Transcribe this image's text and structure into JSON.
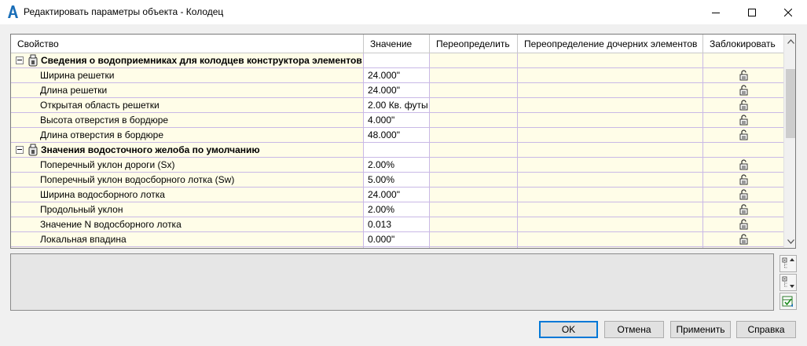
{
  "window": {
    "title": "Редактировать параметры объекта - Колодец",
    "app_icon": "civil3d-app-icon",
    "minimize_icon": "minimize-icon",
    "maximize_icon": "maximize-icon",
    "close_icon": "close-icon"
  },
  "grid": {
    "columns": [
      "Свойство",
      "Значение",
      "Переопределить",
      "Переопределение дочерних элементов",
      "Заблокировать"
    ],
    "groups": [
      {
        "label": "Сведения о водоприемниках для колодцев конструктора элементов",
        "rows": [
          {
            "property": "Ширина решетки",
            "value": "24.000\""
          },
          {
            "property": "Длина решетки",
            "value": "24.000\""
          },
          {
            "property": "Открытая область решетки",
            "value": "2.00 Кв. футы"
          },
          {
            "property": "Высота отверстия в бордюре",
            "value": "4.000\""
          },
          {
            "property": "Длина отверстия в бордюре",
            "value": "48.000\""
          }
        ]
      },
      {
        "label": "Значения водосточного желоба по умолчанию",
        "rows": [
          {
            "property": "Поперечный уклон дороги (Sx)",
            "value": "2.00%"
          },
          {
            "property": "Поперечный уклон водосборного лотка (Sw)",
            "value": "5.00%"
          },
          {
            "property": "Ширина водосборного лотка",
            "value": "24.000\""
          },
          {
            "property": "Продольный уклон",
            "value": "2.00%"
          },
          {
            "property": "Значение N водосборного лотка",
            "value": "0.013"
          },
          {
            "property": "Локальная впадина",
            "value": "0.000\""
          }
        ]
      }
    ]
  },
  "buttons": {
    "ok": "OK",
    "cancel": "Отмена",
    "apply": "Применить",
    "help": "Справка"
  }
}
